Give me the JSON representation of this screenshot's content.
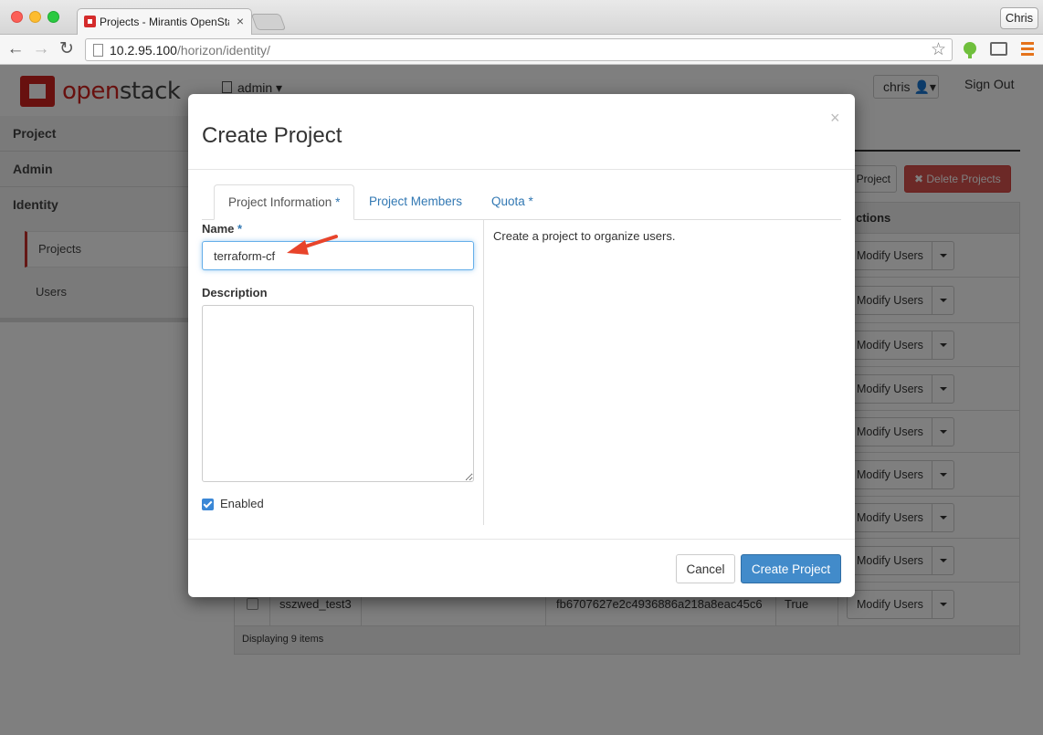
{
  "browser": {
    "tab_title": "Projects - Mirantis OpenStack",
    "tab_close": "×",
    "profile": "Chris",
    "url_host": "10.2.95.100",
    "url_path": "/horizon/identity/"
  },
  "header": {
    "logo_a": "open",
    "logo_b": "stack",
    "context": "admin",
    "user": "chris",
    "sign_out": "Sign Out"
  },
  "sidebar": {
    "dashboards": [
      "Project",
      "Admin",
      "Identity"
    ],
    "panels": [
      "Projects",
      "Users"
    ]
  },
  "background": {
    "create_button": "Project",
    "delete_button": "✖ Delete Projects",
    "actions_header": "ctions",
    "row_action": "Modify Users",
    "last_row": {
      "name": "sszwed_test3",
      "id": "fb6707627e2c4936886a218a8eac45c6",
      "enabled": "True"
    },
    "footer": "Displaying 9 items"
  },
  "modal": {
    "title": "Create Project",
    "close": "×",
    "tabs": [
      {
        "label": "Project Information",
        "required": "*"
      },
      {
        "label": "Project Members",
        "required": ""
      },
      {
        "label": "Quota",
        "required": "*"
      }
    ],
    "name_label": "Name",
    "required_mark": "*",
    "name_value": "terraform-cf",
    "description_label": "Description",
    "description_value": "",
    "enabled_label": "Enabled",
    "enabled": true,
    "help": "Create a project to organize users.",
    "cancel": "Cancel",
    "submit": "Create Project"
  },
  "colors": {
    "primary": "#428bca",
    "danger": "#d9534f",
    "link": "#3278b3",
    "annotation": "#e8442b"
  }
}
